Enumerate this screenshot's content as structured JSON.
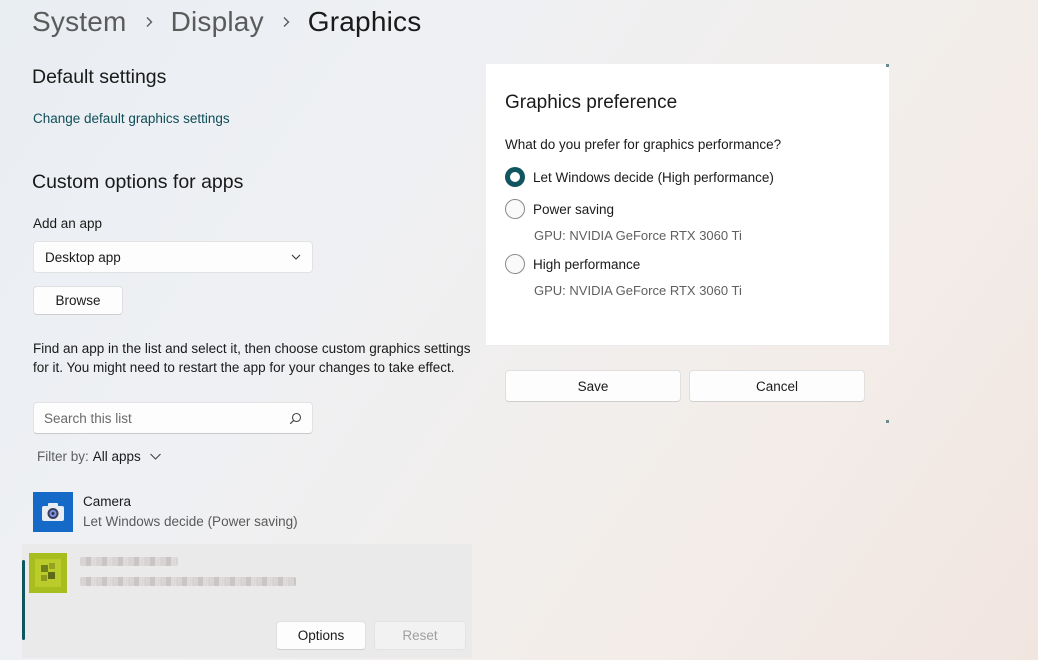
{
  "breadcrumb": {
    "items": [
      "System",
      "Display",
      "Graphics"
    ]
  },
  "default_settings": {
    "heading": "Default settings",
    "link": "Change default graphics settings"
  },
  "custom_options": {
    "heading": "Custom options for apps",
    "add_app_label": "Add an app",
    "app_type_selected": "Desktop app",
    "browse_label": "Browse",
    "description": "Find an app in the list and select it, then choose custom graphics settings for it. You might need to restart the app for your changes to take effect.",
    "search_placeholder": "Search this list",
    "filter_label": "Filter by:",
    "filter_value": "All apps"
  },
  "apps": [
    {
      "name": "Camera",
      "preference": "Let Windows decide (Power saving)",
      "icon": "camera-icon"
    }
  ],
  "selected_app": {
    "options_label": "Options",
    "reset_label": "Reset"
  },
  "graphics_preference": {
    "title": "Graphics preference",
    "question": "What do you prefer for graphics performance?",
    "options": [
      {
        "label": "Let Windows decide (High performance)",
        "gpu": "",
        "checked": true
      },
      {
        "label": "Power saving",
        "gpu": "GPU: NVIDIA GeForce RTX 3060 Ti",
        "checked": false
      },
      {
        "label": "High performance",
        "gpu": "GPU: NVIDIA GeForce RTX 3060 Ti",
        "checked": false
      }
    ],
    "save_label": "Save",
    "cancel_label": "Cancel"
  },
  "colors": {
    "accent": "#0f5560",
    "camera_tile": "#1569c7"
  }
}
